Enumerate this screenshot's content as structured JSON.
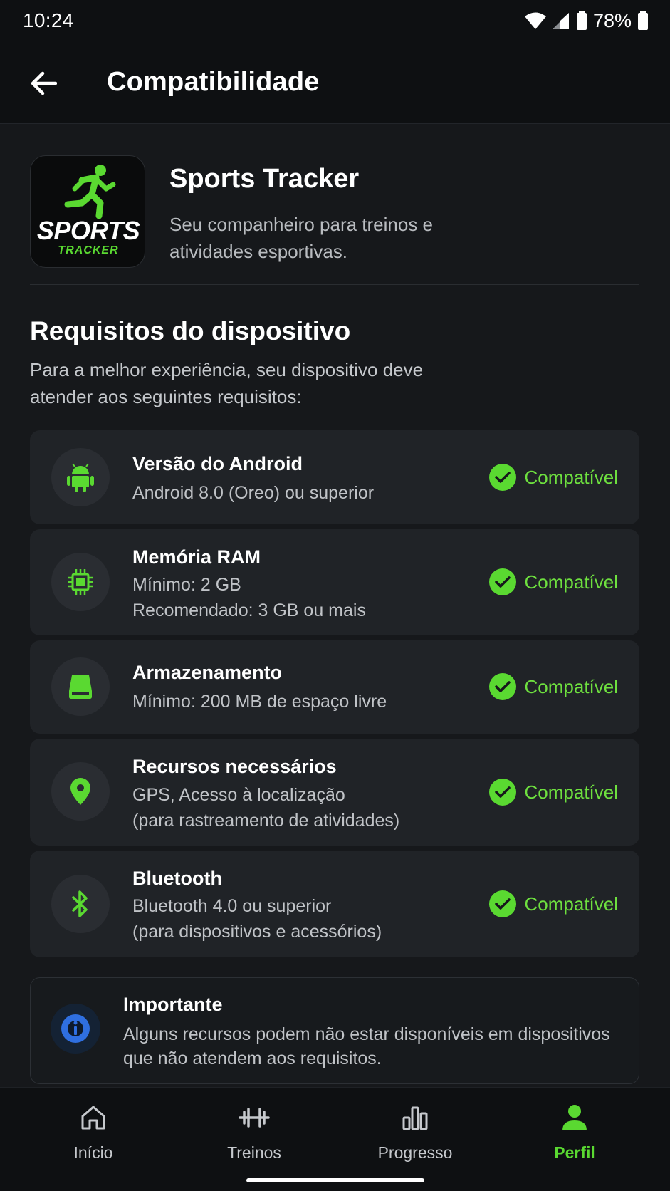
{
  "status_bar": {
    "time": "10:24",
    "battery": "78%"
  },
  "app_bar": {
    "title": "Compatibilidade",
    "back_icon": "arrow-back-icon"
  },
  "app": {
    "logo_text_main": "SPORTS",
    "logo_text_sub": "TRACKER",
    "name": "Sports Tracker",
    "description": "Seu companheiro para treinos e atividades esportivas."
  },
  "requirements": {
    "title": "Requisitos do dispositivo",
    "description": "Para a melhor experiência, seu dispositivo deve atender aos seguintes requisitos:",
    "items": [
      {
        "icon": "android-icon",
        "title": "Versão do Android",
        "lines": [
          "Android 8.0 (Oreo) ou superior"
        ],
        "status": "Compatível"
      },
      {
        "icon": "chip-icon",
        "title": "Memória RAM",
        "lines": [
          "Mínimo: 2 GB",
          "Recomendado: 3 GB ou mais"
        ],
        "status": "Compatível"
      },
      {
        "icon": "storage-icon",
        "title": "Armazenamento",
        "lines": [
          "Mínimo: 200 MB de espaço livre"
        ],
        "status": "Compatível"
      },
      {
        "icon": "location-pin-icon",
        "title": "Recursos necessários",
        "lines": [
          "GPS, Acesso à localização",
          "(para rastreamento de atividades)"
        ],
        "status": "Compatível"
      },
      {
        "icon": "bluetooth-icon",
        "title": "Bluetooth",
        "lines": [
          "Bluetooth 4.0 ou superior",
          "(para dispositivos e acessórios)"
        ],
        "status": "Compatível"
      }
    ]
  },
  "notice": {
    "title": "Importante",
    "text": "Alguns recursos podem não estar disponíveis em dispositivos que não atendem aos requisitos."
  },
  "bottom_nav": {
    "items": [
      {
        "label": "Início",
        "icon": "home-icon",
        "active": false
      },
      {
        "label": "Treinos",
        "icon": "dumbbell-icon",
        "active": false
      },
      {
        "label": "Progresso",
        "icon": "bar-chart-icon",
        "active": false
      },
      {
        "label": "Perfil",
        "icon": "person-icon",
        "active": true
      }
    ]
  },
  "colors": {
    "accent": "#5ad931",
    "background": "#16181b",
    "card": "#202327",
    "info_blue": "#2f6fe0"
  }
}
